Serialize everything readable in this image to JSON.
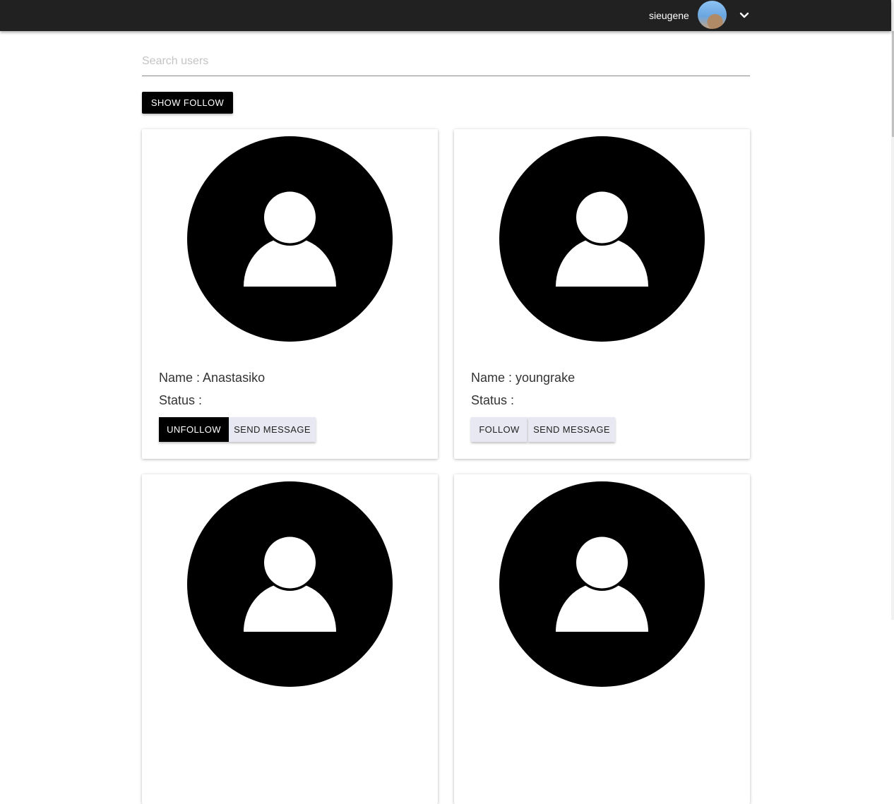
{
  "header": {
    "username": "sieugene"
  },
  "search": {
    "placeholder": "Search users",
    "value": ""
  },
  "show_follow_label": "SHOW FOLLOW",
  "users": [
    {
      "name_text": "Name : Anastasiko",
      "status_text": "Status :",
      "follow_label": "UNFOLLOW",
      "message_label": "SEND MESSAGE"
    },
    {
      "name_text": "Name : youngrake",
      "status_text": "Status :",
      "follow_label": "FOLLOW",
      "message_label": "SEND MESSAGE"
    },
    {
      "name_text": "",
      "status_text": "",
      "follow_label": "",
      "message_label": ""
    },
    {
      "name_text": "",
      "status_text": "",
      "follow_label": "",
      "message_label": ""
    }
  ],
  "icons": {
    "avatar": "user-avatar-photo",
    "dropdown": "chevron-down-icon",
    "profile_placeholder": "default-user-icon"
  },
  "colors": {
    "topbar": "#212121",
    "primary_button": "#000000",
    "secondary_button": "#e8e8f2"
  }
}
